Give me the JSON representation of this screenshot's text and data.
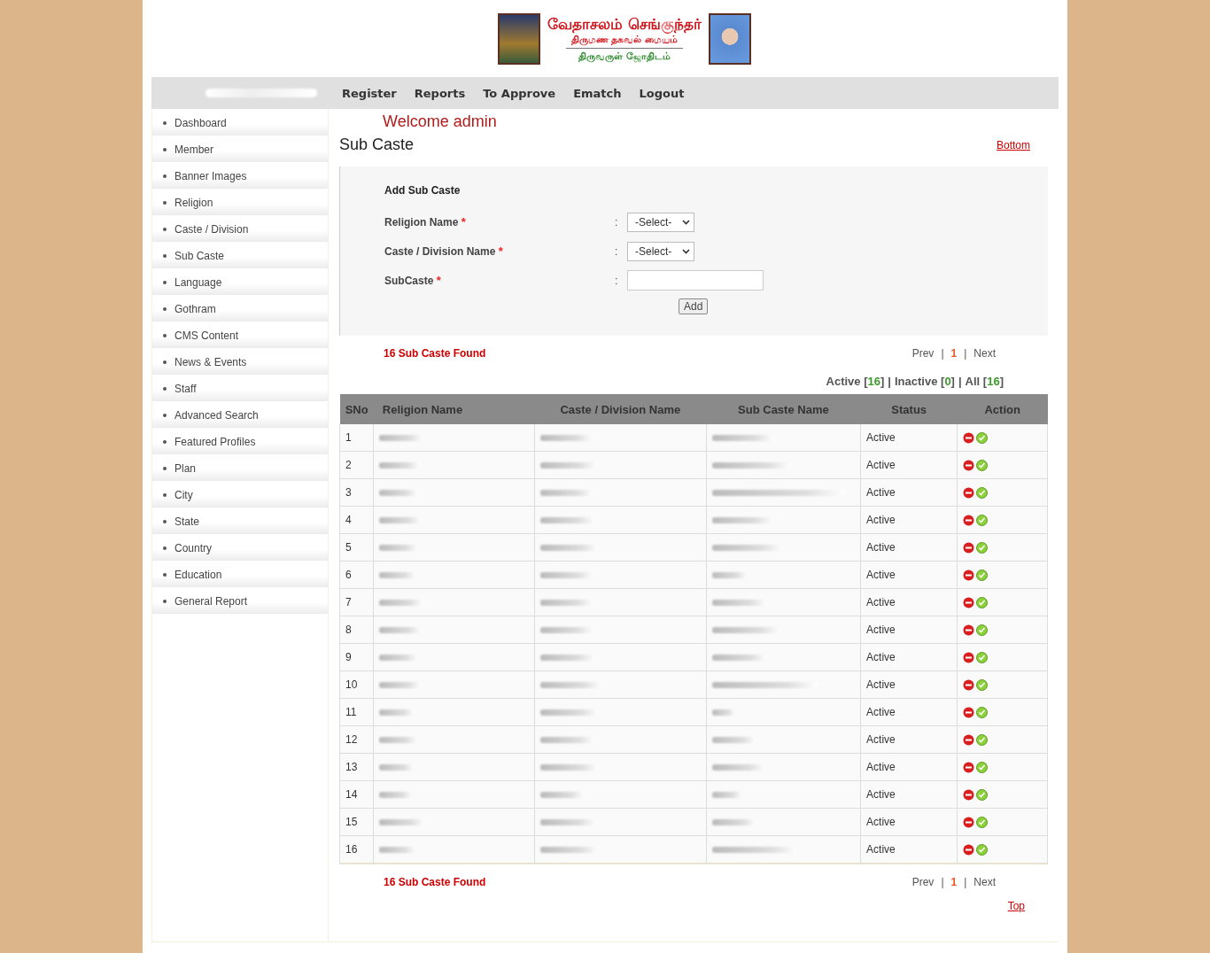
{
  "logo": {
    "title": "வேதாசலம் செங்குந்தர்",
    "subtitle": "திருமண தகவல் மையம்",
    "tagline": "திருவருள் ஜோதிடம்"
  },
  "nav": {
    "items": [
      "Register",
      "Reports",
      "To Approve",
      "Ematch",
      "Logout"
    ]
  },
  "sidebar": {
    "items": [
      {
        "label": "Dashboard",
        "selected": false
      },
      {
        "label": "Member",
        "selected": false
      },
      {
        "label": "Banner Images",
        "selected": false
      },
      {
        "label": "Religion",
        "selected": false
      },
      {
        "label": "Caste / Division",
        "selected": false
      },
      {
        "label": "Sub Caste",
        "selected": false
      },
      {
        "label": "Language",
        "selected": false
      },
      {
        "label": "Gothram",
        "selected": false
      },
      {
        "label": "CMS Content",
        "selected": false
      },
      {
        "label": "News & Events",
        "selected": false
      },
      {
        "label": "Staff",
        "selected": false
      },
      {
        "label": "Advanced Search",
        "selected": false
      },
      {
        "label": "Featured Profiles",
        "selected": false
      },
      {
        "label": "Plan",
        "selected": false
      },
      {
        "label": "City",
        "selected": false
      },
      {
        "label": "State",
        "selected": false
      },
      {
        "label": "Country",
        "selected": false
      },
      {
        "label": "Education",
        "selected": false
      },
      {
        "label": "General Report",
        "selected": false
      }
    ]
  },
  "welcome": "Welcome admin",
  "page_title": "Sub Caste",
  "bottom_link": "Bottom",
  "form": {
    "title": "Add Sub Caste",
    "fields": [
      {
        "kind": "select",
        "label": "Religion Name",
        "required": "*",
        "separator": ":",
        "value": "-Select-"
      },
      {
        "kind": "select",
        "label": "Caste / Division Name",
        "required": "*",
        "separator": ":",
        "value": "-Select-"
      },
      {
        "kind": "text",
        "label": "SubCaste",
        "required": "*",
        "separator": ":"
      }
    ],
    "submit": "Add"
  },
  "summary_top": {
    "found": "16 Sub Caste Found",
    "prev": "Prev",
    "sep1": "|",
    "page": "1",
    "sep2": "|",
    "next": "Next"
  },
  "filters": [
    {
      "label": "Active",
      "open": "[",
      "count": "16",
      "close": "]"
    },
    {
      "label": "Inactive",
      "open": "[",
      "count": "0",
      "close": "]"
    },
    {
      "label": "All",
      "open": "[",
      "count": "16",
      "close": "]"
    }
  ],
  "filter_separator": "|",
  "table": {
    "columns": [
      "SNo",
      "Religion Name",
      "Caste / Division Name",
      "Sub Caste Name",
      "Status",
      "Action"
    ],
    "rows": [
      {
        "sno": "1",
        "status": "Active"
      },
      {
        "sno": "2",
        "status": "Active"
      },
      {
        "sno": "3",
        "status": "Active"
      },
      {
        "sno": "4",
        "status": "Active"
      },
      {
        "sno": "5",
        "status": "Active"
      },
      {
        "sno": "6",
        "status": "Active"
      },
      {
        "sno": "7",
        "status": "Active"
      },
      {
        "sno": "8",
        "status": "Active"
      },
      {
        "sno": "9",
        "status": "Active"
      },
      {
        "sno": "10",
        "status": "Active"
      },
      {
        "sno": "11",
        "status": "Active"
      },
      {
        "sno": "12",
        "status": "Active"
      },
      {
        "sno": "13",
        "status": "Active"
      },
      {
        "sno": "14",
        "status": "Active"
      },
      {
        "sno": "15",
        "status": "Active"
      },
      {
        "sno": "16",
        "status": "Active"
      }
    ]
  },
  "summary_bottom": {
    "found": "16 Sub Caste Found",
    "prev": "Prev",
    "sep1": "|",
    "page": "1",
    "sep2": "|",
    "next": "Next"
  },
  "top_link": "Top"
}
